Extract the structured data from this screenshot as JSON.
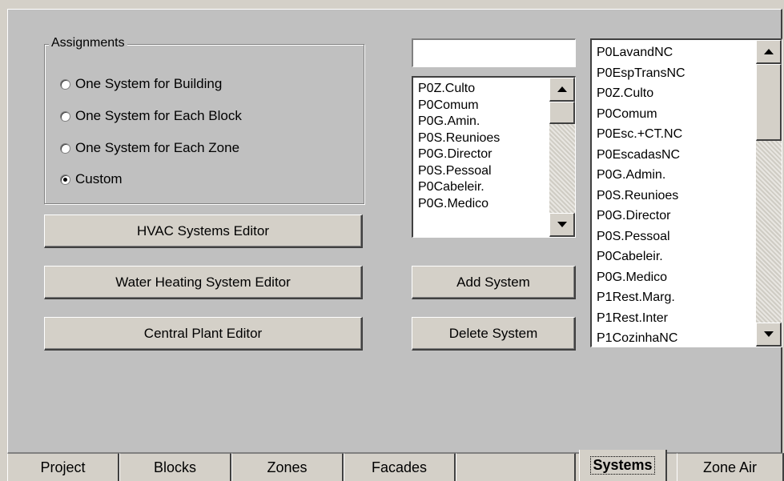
{
  "assignments": {
    "title": "Assignments",
    "options": [
      {
        "label": "One System for Building",
        "checked": false
      },
      {
        "label": "One System for Each Block",
        "checked": false
      },
      {
        "label": "One System for Each Zone",
        "checked": false
      },
      {
        "label": "Custom",
        "checked": true
      }
    ]
  },
  "buttons": {
    "hvac": "HVAC Systems Editor",
    "water_heating": "Water Heating System Editor",
    "central_plant": "Central Plant Editor",
    "add_system": "Add System",
    "delete_system": "Delete System"
  },
  "system_name_input": {
    "value": ""
  },
  "zones_list": {
    "items": [
      "P0Z.Culto",
      "P0Comum",
      "P0G.Amin.",
      "P0S.Reunioes",
      "P0G.Director",
      "P0S.Pessoal",
      "P0Cabeleir.",
      "P0G.Medico"
    ]
  },
  "systems_list": {
    "items": [
      "P0LavandNC",
      "P0EspTransNC",
      "P0Z.Culto",
      "P0Comum",
      "P0Esc.+CT.NC",
      "P0EscadasNC",
      "P0G.Admin.",
      "P0S.Reunioes",
      "P0G.Director",
      "P0S.Pessoal",
      "P0Cabeleir.",
      "P0G.Medico",
      "P1Rest.Marg.",
      "P1Rest.Inter",
      "P1CozinhaNC"
    ]
  },
  "tabs": [
    {
      "label": "Project",
      "active": false
    },
    {
      "label": "Blocks",
      "active": false
    },
    {
      "label": "Zones",
      "active": false
    },
    {
      "label": "Facades",
      "active": false
    },
    {
      "label": "",
      "active": false
    },
    {
      "label": "Systems",
      "active": true
    },
    {
      "label": "Zone Air",
      "active": false
    }
  ]
}
